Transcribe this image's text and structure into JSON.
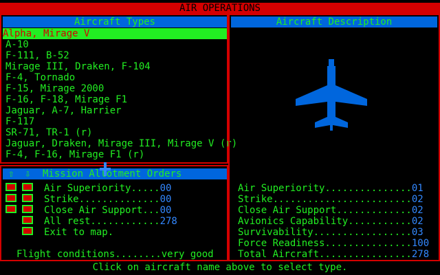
{
  "window": {
    "title": "AIR OPERATIONS"
  },
  "aircraft_types": {
    "header": "Aircraft Types",
    "items": [
      "Alpha, Mirage V",
      "A-10",
      "F-111, B-52",
      "Mirage III, Draken, F-104",
      "F-4, Tornado",
      "F-15, Mirage 2000",
      "F-16, F-18, Mirage F1",
      "Jaguar, A-7, Harrier",
      "F-117",
      "SR-71, TR-1 (r)",
      "Jaguar, Draken, Mirage III, Mirage V (r)",
      "F-4, F-16, Mirage F1 (r)"
    ]
  },
  "description": {
    "header": "Aircraft Description"
  },
  "mission_orders": {
    "header": "Mission Allotment Orders",
    "up_arrow": "⇧",
    "down_arrow": "⇩",
    "rows": [
      {
        "label": "Air Superiority.....",
        "value": "00"
      },
      {
        "label": "Strike..............",
        "value": "00"
      },
      {
        "label": "Close Air Support...",
        "value": "00"
      },
      {
        "label": "All rest............",
        "value": "278"
      },
      {
        "label": "Exit to map.",
        "value": ""
      }
    ],
    "flight_label": "Flight conditions........",
    "flight_value": "very good"
  },
  "stats": [
    {
      "label": "Air Superiority...............",
      "value": "01"
    },
    {
      "label": "Strike........................",
      "value": "02"
    },
    {
      "label": "Close Air Support.............",
      "value": "02"
    },
    {
      "label": "Avionics Capability...........",
      "value": "02"
    },
    {
      "label": "Survivability.................",
      "value": "03"
    },
    {
      "label": "Force Readiness...............",
      "value": "100"
    },
    {
      "label": "Total Aircraft................",
      "value": "278"
    }
  ],
  "status": "Click on aircraft name above to select type.",
  "colors": {
    "accent": "#d40000",
    "header": "#0066dd",
    "text": "#22ee22",
    "value": "#3388ff"
  }
}
